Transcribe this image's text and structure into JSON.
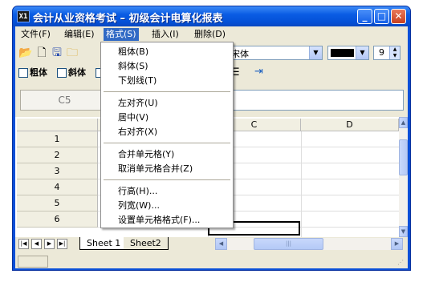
{
  "window": {
    "title": "会计从业资格考试 – 初级会计电算化报表",
    "app_icon_text": "X1"
  },
  "menubar": [
    "文件(F)",
    "编辑(E)",
    "格式(S)",
    "插入(I)",
    "删除(D)"
  ],
  "toolbar": {
    "font_name": "宋体",
    "font_size": "9",
    "bold_label": "粗体",
    "italic_label": "斜体"
  },
  "name_box": "C5",
  "columns": [
    "C",
    "D"
  ],
  "rows": [
    "1",
    "2",
    "3",
    "4",
    "5",
    "6"
  ],
  "sheets": [
    "Sheet 1",
    "Sheet2"
  ],
  "format_menu": {
    "items": [
      "粗体(B)",
      "斜体(S)",
      "下划线(T)",
      "左对齐(U)",
      "居中(V)",
      "右对齐(X)",
      "合并单元格(Y)",
      "取消单元格合并(Z)",
      "行高(H)...",
      "列宽(W)...",
      "设置单元格格式(F)..."
    ]
  },
  "colors": {
    "title_bar": "#0a5ce4",
    "menu_highlight": "#316ac5",
    "chrome": "#ece9d8"
  }
}
